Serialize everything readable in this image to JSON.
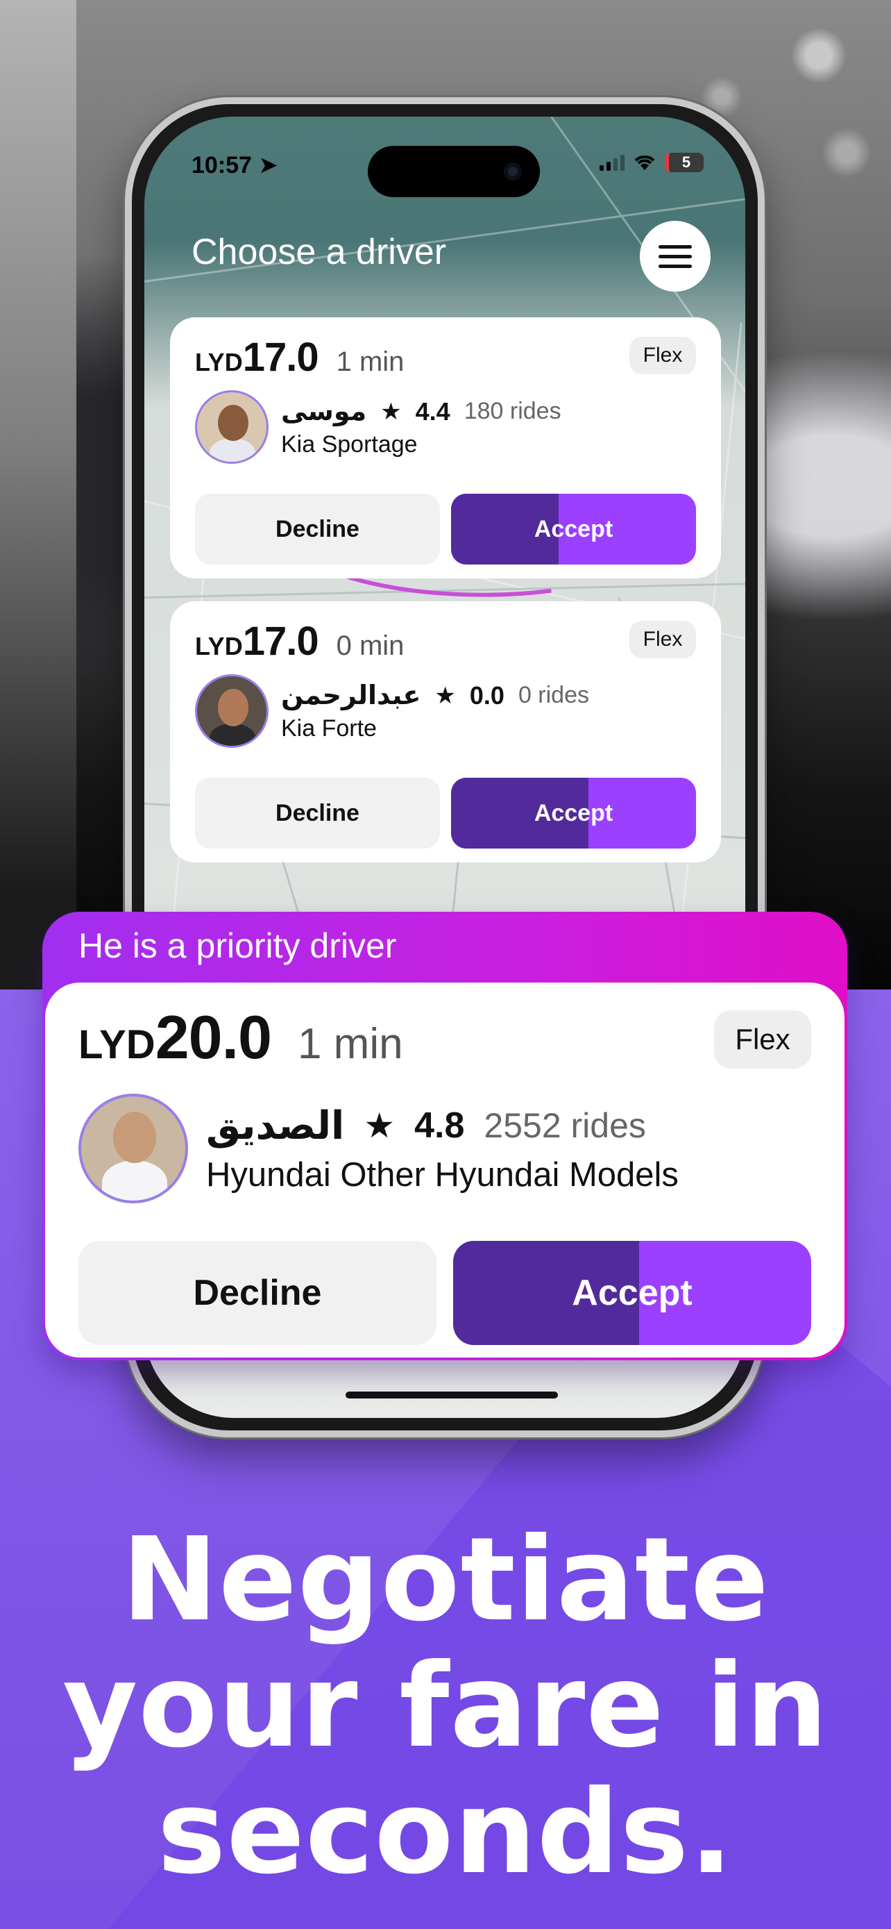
{
  "status_bar": {
    "time": "10:57",
    "battery": "5"
  },
  "app": {
    "title": "Choose a driver",
    "menu_icon": "hamburger-icon"
  },
  "offers": [
    {
      "currency": "LYD",
      "price": "17.0",
      "eta": "1 min",
      "badge": "Flex",
      "driver_name": "موسى",
      "rating": "4.4",
      "rides": "180 rides",
      "car": "Kia Sportage",
      "decline_label": "Decline",
      "accept_label": "Accept",
      "accept_progress": 0.44
    },
    {
      "currency": "LYD",
      "price": "17.0",
      "eta": "0 min",
      "badge": "Flex",
      "driver_name": "عبدالرحمن",
      "rating": "0.0",
      "rides": "0 rides",
      "car": "Kia Forte",
      "decline_label": "Decline",
      "accept_label": "Accept",
      "accept_progress": 0.56
    }
  ],
  "priority": {
    "label": "He is a priority driver",
    "currency": "LYD",
    "price": "20.0",
    "eta": "1 min",
    "badge": "Flex",
    "driver_name": "الصديق",
    "rating": "4.8",
    "rides": "2552 rides",
    "car": "Hyundai Other Hyundai Models",
    "decline_label": "Decline",
    "accept_label": "Accept",
    "accept_progress": 0.52
  },
  "headline": {
    "line1": "Negotiate",
    "line2": "your fare in",
    "line3": "seconds."
  },
  "colors": {
    "accent_purple": "#9b40ff",
    "accept_dark": "#532a9c",
    "priority_gradient_start": "#a12ff0",
    "priority_gradient_end": "#e00ec7",
    "background_purple": "#7c4de6"
  }
}
